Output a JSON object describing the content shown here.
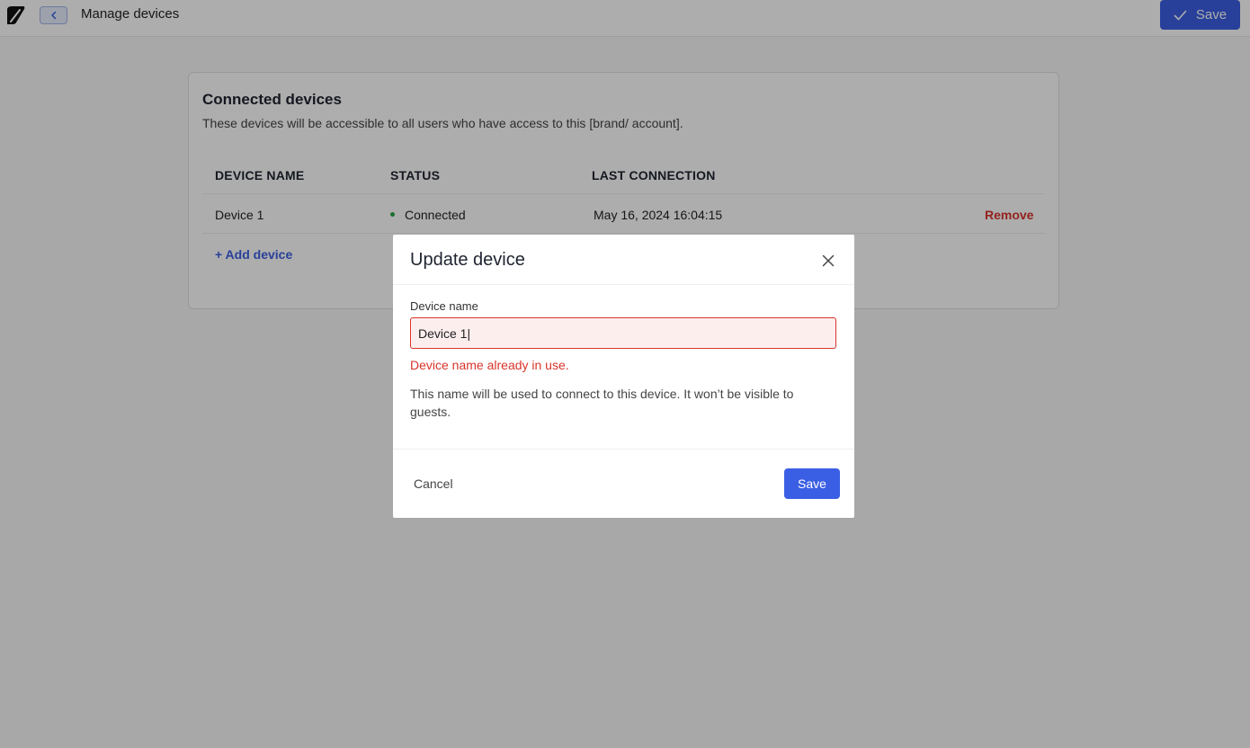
{
  "header": {
    "title": "Manage devices",
    "save_label": "Save"
  },
  "card": {
    "title": "Connected devices",
    "subtitle": "These devices will be accessible to all users who have access to this [brand/ account].",
    "columns": [
      "DEVICE NAME",
      "STATUS",
      "LAST CONNECTION"
    ],
    "rows": [
      {
        "name": "Device 1",
        "status": "Connected",
        "last_connection": "May 16, 2024 16:04:15",
        "action": "Remove"
      }
    ],
    "add_label": "+ Add device"
  },
  "modal": {
    "title": "Update device",
    "field_label": "Device name",
    "field_value": "Device 1|",
    "error": "Device name already in use.",
    "help": "This name will be used to connect to this device. It won’t be visible to guests.",
    "cancel_label": "Cancel",
    "save_label": "Save"
  },
  "icons": {
    "logo": "app-logo-icon",
    "back": "chevron-left-icon",
    "check": "check-icon",
    "close": "close-icon",
    "status": "status-dot-icon"
  },
  "colors": {
    "accent": "#3b5fe4",
    "error": "#d9342b",
    "success": "#28a745"
  }
}
